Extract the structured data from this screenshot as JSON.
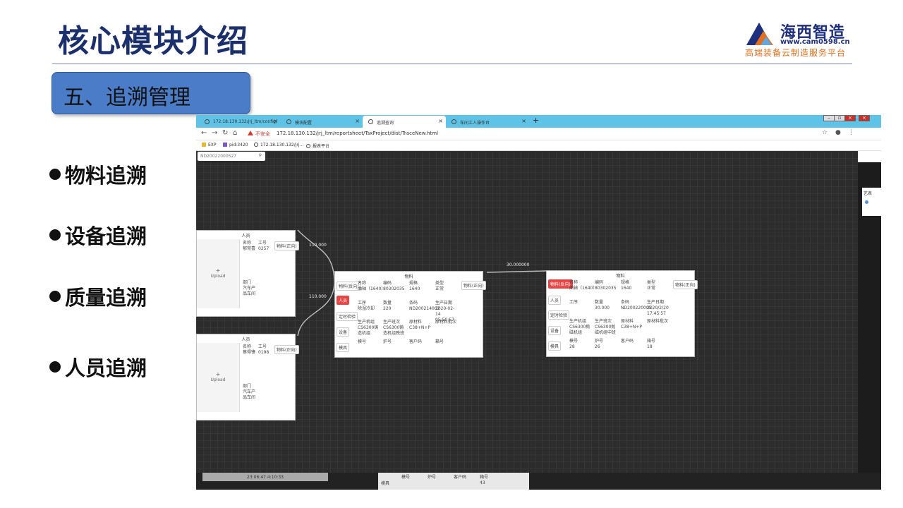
{
  "slide": {
    "title": "核心模块介绍",
    "section": "五、追溯管理",
    "bullets": [
      "物料追溯",
      "设备追溯",
      "质量追溯",
      "人员追溯"
    ],
    "logo": {
      "name": "海西智造",
      "url": "www.cam0598.cn",
      "tagline": "高端装备云制造服务平台"
    }
  },
  "browser": {
    "tabs": [
      {
        "label": "172.18.130.132/jrj_ltm/config/"
      },
      {
        "label": "模块配置"
      },
      {
        "label": "追溯查询"
      },
      {
        "label": "车间工人操作台"
      }
    ],
    "insecure": "不安全",
    "url": "172.18.130.132/jrj_ltm/reportsheet/TsxProject/dist/TraceNew.html",
    "bookmarks": [
      "EXP",
      "pid:3420",
      "172.18.130.132/jrj...",
      "报表平台"
    ]
  },
  "canvas": {
    "search_value": "ND20022000527",
    "edges": [
      "110.000",
      "110.000",
      "30.000000"
    ],
    "person_cards": [
      {
        "title": "人员",
        "upload": "Upload",
        "name_label": "名称",
        "name": "郁常喜",
        "id_label": "工号",
        "id": "0257",
        "dept_label": "部门",
        "dept": "汽车产品车间",
        "btn": "物料(正向)"
      },
      {
        "title": "人员",
        "upload": "Upload",
        "name_label": "名称",
        "name": "蔡得锋",
        "id_label": "工号",
        "id": "0198",
        "dept_label": "部门",
        "dept": "汽车产品车间",
        "btn": "物料(正向)"
      }
    ],
    "material_cards": [
      {
        "title": "物料",
        "left_btns": [
          "物料(反向)",
          "人员",
          "定时检验",
          "设备",
          "模具"
        ],
        "right_btn": "物料(正向)",
        "h1": [
          "名称",
          "编码",
          "规格",
          "类型"
        ],
        "v1": [
          "曲轴（1640）",
          "80302035",
          "1640",
          "正常"
        ],
        "h2": [
          "工序",
          "数量",
          "条码",
          "生产日期"
        ],
        "v2": [
          "除湿冷却",
          "220",
          "ND200214002",
          "2020-02-14 05:50:57"
        ],
        "h3": [
          "生产机组",
          "生产班次",
          "原材料",
          "原材料批次"
        ],
        "v3": [
          "CS6300铸造机组",
          "CS6300铸造机组晚班",
          "C38+N+P",
          ""
        ],
        "h4": [
          "模号",
          "炉号",
          "客户码",
          "箱号"
        ],
        "v4": [
          "",
          "",
          "",
          ""
        ]
      },
      {
        "title": "物料",
        "left_btns": [
          "物料(反向)",
          "人员",
          "定时检验",
          "设备",
          "模具"
        ],
        "right_btn": "物料(正向)",
        "h1": [
          "名称",
          "编码",
          "规格",
          "类型"
        ],
        "v1": [
          "曲轴（1640）",
          "80302035",
          "1640",
          "正常"
        ],
        "h2": [
          "工序",
          "数量",
          "条码",
          "生产日期"
        ],
        "v2": [
          "",
          "30.000",
          "ND200220005",
          "2020/2/20 17:45:57"
        ],
        "h3": [
          "生产机组",
          "生产班次",
          "原材料",
          "原材料批次"
        ],
        "v3": [
          "CS6300抛磁机组",
          "CS6300抛磁机组中班",
          "C38+N+P",
          ""
        ],
        "h4": [
          "模号",
          "炉号",
          "客户码",
          "箱号"
        ],
        "v4": [
          "28",
          "26",
          "",
          "18"
        ]
      }
    ],
    "right_panel_text": "艺表",
    "bottom": {
      "timestamp": "23:06:47 4:10:33",
      "mold": "模具",
      "h": [
        "模号",
        "炉号",
        "客户码",
        "箱号"
      ],
      "box": "43"
    }
  }
}
